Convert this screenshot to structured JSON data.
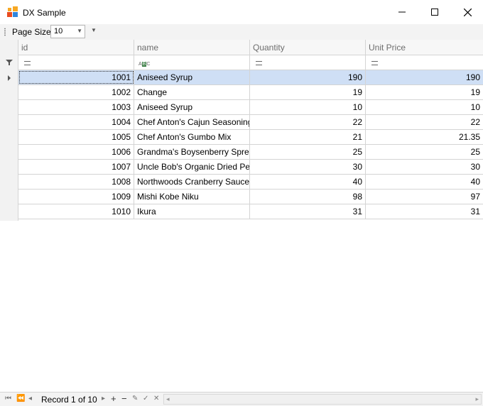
{
  "window": {
    "title": "DX Sample",
    "icon_colors": [
      "#f7a823",
      "#e94b1f",
      "#2e86de",
      "#f7a823"
    ]
  },
  "toolbar": {
    "page_size_label": "Page Size",
    "page_size_value": "10"
  },
  "grid": {
    "columns": [
      {
        "key": "id",
        "label": "id",
        "filter_icon": "equals-icon"
      },
      {
        "key": "name",
        "label": "name",
        "filter_icon": "abc-text-icon"
      },
      {
        "key": "quantity",
        "label": "Quantity",
        "filter_icon": "equals-icon"
      },
      {
        "key": "unit_price",
        "label": "Unit Price",
        "filter_icon": "equals-icon"
      }
    ],
    "rows": [
      {
        "id": "1001",
        "name": "Aniseed Syrup",
        "quantity": "190",
        "unit_price": "190"
      },
      {
        "id": "1002",
        "name": "Change",
        "quantity": "19",
        "unit_price": "19"
      },
      {
        "id": "1003",
        "name": "Aniseed Syrup",
        "quantity": "10",
        "unit_price": "10"
      },
      {
        "id": "1004",
        "name": "Chef Anton's Cajun Seasoning",
        "quantity": "22",
        "unit_price": "22"
      },
      {
        "id": "1005",
        "name": "Chef Anton's Gumbo Mix",
        "quantity": "21",
        "unit_price": "21.35"
      },
      {
        "id": "1006",
        "name": "Grandma's Boysenberry Spread",
        "quantity": "25",
        "unit_price": "25"
      },
      {
        "id": "1007",
        "name": "Uncle Bob's Organic Dried Pears",
        "quantity": "30",
        "unit_price": "30"
      },
      {
        "id": "1008",
        "name": "Northwoods Cranberry Sauce",
        "quantity": "40",
        "unit_price": "40"
      },
      {
        "id": "1009",
        "name": "Mishi Kobe Niku",
        "quantity": "98",
        "unit_price": "97"
      },
      {
        "id": "1010",
        "name": "Ikura",
        "quantity": "31",
        "unit_price": "31"
      }
    ],
    "selected_row": 0,
    "selection_color": "#cfdff5"
  },
  "navigator": {
    "record_text": "Record 1 of 10"
  }
}
